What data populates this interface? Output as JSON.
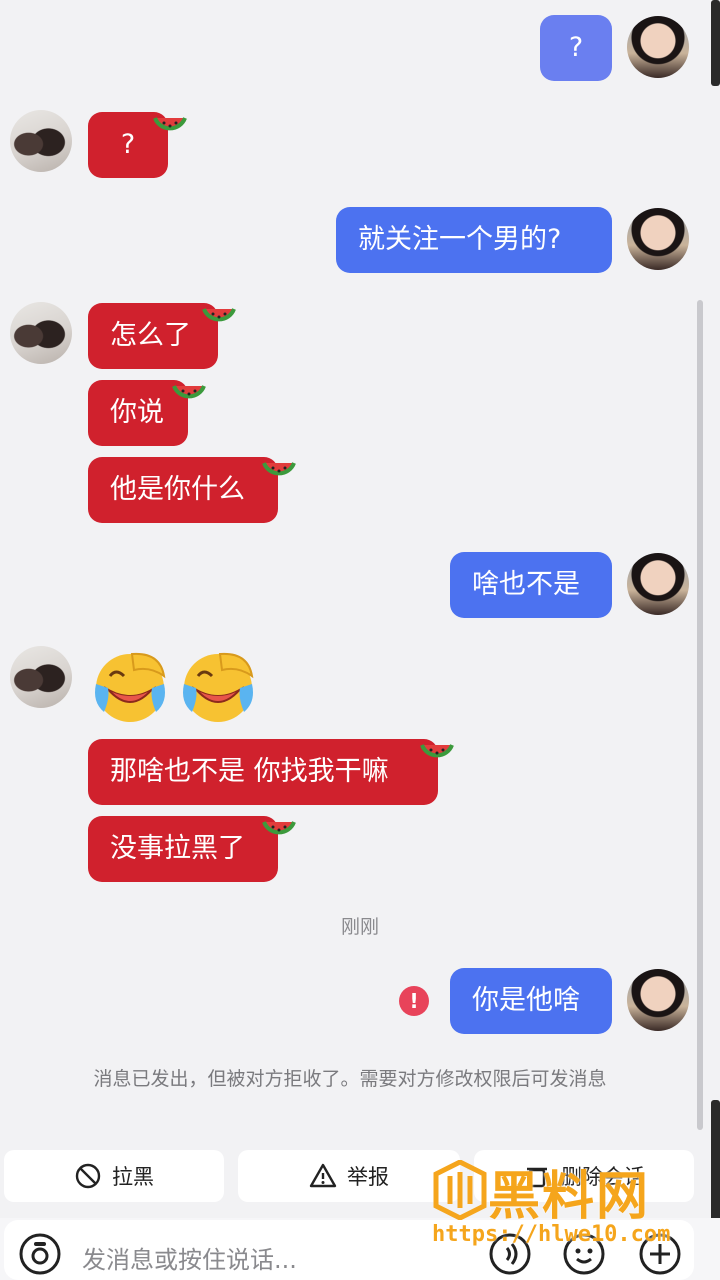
{
  "messages": {
    "m1": "?",
    "m2": "?",
    "m3": "就关注一个男的?",
    "m4": "怎么了",
    "m5": "你说",
    "m6": "他是你什么",
    "m7": "啥也不是",
    "m9": "那啥也不是 你找我干嘛",
    "m10": "没事拉黑了",
    "m11": "你是他啥"
  },
  "timestamp": "刚刚",
  "error_mark": "!",
  "notice": "消息已发出，但被对方拒收了。需要对方修改权限后可发消息",
  "actions": {
    "block_label": "拉黑",
    "report_label": "举报",
    "delete_label": "删除会话"
  },
  "input": {
    "placeholder": "发消息或按住说话..."
  },
  "watermark": {
    "title": "黑料网",
    "url": "https://hlwe10.com"
  },
  "colors": {
    "my_bubble": "#4c72f0",
    "their_bubble": "#d0212d",
    "background": "#f2f2f4",
    "watermark": "#f5a51c"
  },
  "icons": [
    "camera-icon",
    "voice-icon",
    "emoji-icon",
    "plus-icon",
    "block-icon",
    "warning-icon",
    "watermelon-icon",
    "laughing-crying-emoji"
  ]
}
